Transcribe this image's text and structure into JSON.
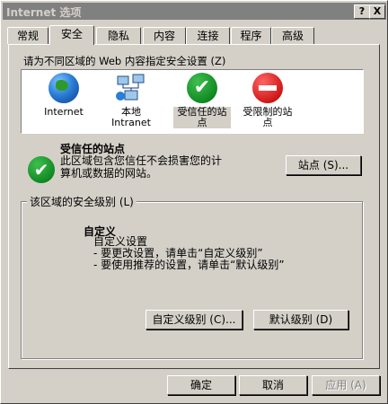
{
  "window": {
    "title": "Internet 选项",
    "help_button": "?",
    "close_button": "X"
  },
  "tabs": [
    {
      "label": "常规"
    },
    {
      "label": "安全"
    },
    {
      "label": "隐私"
    },
    {
      "label": "内容"
    },
    {
      "label": "连接"
    },
    {
      "label": "程序"
    },
    {
      "label": "高级"
    }
  ],
  "zones": {
    "prompt": "请为不同区域的 Web 内容指定安全设置 (Z)",
    "items": [
      {
        "label": "Internet",
        "icon": "globe-icon"
      },
      {
        "label": "本地\nIntranet",
        "icon": "intranet-icon"
      },
      {
        "label": "受信任的站点",
        "icon": "trusted-check-icon"
      },
      {
        "label": "受限制的站点",
        "icon": "restricted-stop-icon"
      }
    ]
  },
  "selected_zone": {
    "title": "受信任的站点",
    "description": "此区域包含您信任不会损害您的计算机或数据的网站。",
    "sites_button": "站点 (S)..."
  },
  "security_level": {
    "group_label": "该区域的安全级别 (L)",
    "title": "自定义",
    "lines": [
      "自定义设置",
      "- 要更改设置，请单击“自定义级别”",
      "- 要使用推荐的设置，请单击“默认级别”"
    ],
    "custom_button": "自定义级别 (C)...",
    "default_button": "默认级别 (D)"
  },
  "footer": {
    "ok_button": "确定",
    "cancel_button": "取消",
    "apply_button": "应用 (A)"
  }
}
